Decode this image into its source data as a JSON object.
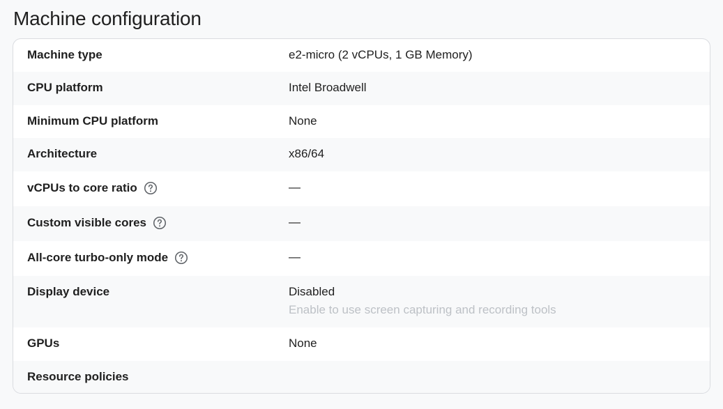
{
  "title": "Machine configuration",
  "rows": [
    {
      "label": "Machine type",
      "value": "e2-micro (2 vCPUs, 1 GB Memory)"
    },
    {
      "label": "CPU platform",
      "value": "Intel Broadwell"
    },
    {
      "label": "Minimum CPU platform",
      "value": "None"
    },
    {
      "label": "Architecture",
      "value": "x86/64"
    },
    {
      "label": "vCPUs to core ratio",
      "value": "—",
      "help_icon": "help-circle-icon"
    },
    {
      "label": "Custom visible cores",
      "value": "—",
      "help_icon": "help-circle-icon"
    },
    {
      "label": "All-core turbo-only mode",
      "value": "—",
      "help_icon": "help-circle-icon"
    },
    {
      "label": "Display device",
      "value": "Disabled",
      "sub": "Enable to use screen capturing and recording tools"
    },
    {
      "label": "GPUs",
      "value": "None"
    },
    {
      "label": "Resource policies",
      "value": ""
    }
  ],
  "colors": {
    "page_bg": "#f8f9fa",
    "card_bg": "#ffffff",
    "shaded_row": "#f8f9fa",
    "border": "#dadce0",
    "text": "#1f1f1f",
    "muted": "#bdc1c6"
  }
}
